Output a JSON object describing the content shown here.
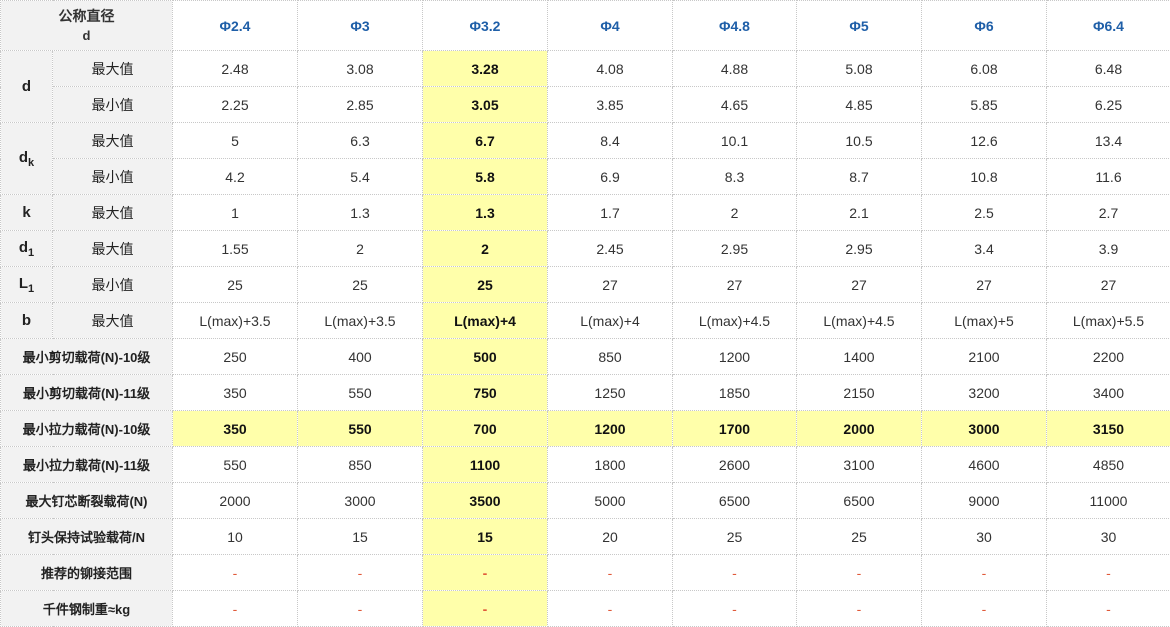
{
  "header": {
    "title_line1": "公称直径",
    "title_line2": "d",
    "columns": [
      "Φ2.4",
      "Φ3",
      "Φ3.2",
      "Φ4",
      "Φ4.8",
      "Φ5",
      "Φ6",
      "Φ6.4"
    ]
  },
  "highlight": {
    "column_index": 2,
    "row_label": "最小拉力载荷(N)-10级",
    "color": "#ffffaa"
  },
  "groups": [
    {
      "symbol": "d",
      "sub": "",
      "rows": [
        {
          "label": "最大值",
          "values": [
            "2.48",
            "3.08",
            "3.28",
            "4.08",
            "4.88",
            "5.08",
            "6.08",
            "6.48"
          ]
        },
        {
          "label": "最小值",
          "values": [
            "2.25",
            "2.85",
            "3.05",
            "3.85",
            "4.65",
            "4.85",
            "5.85",
            "6.25"
          ]
        }
      ]
    },
    {
      "symbol": "d",
      "sub": "k",
      "rows": [
        {
          "label": "最大值",
          "values": [
            "5",
            "6.3",
            "6.7",
            "8.4",
            "10.1",
            "10.5",
            "12.6",
            "13.4"
          ]
        },
        {
          "label": "最小值",
          "values": [
            "4.2",
            "5.4",
            "5.8",
            "6.9",
            "8.3",
            "8.7",
            "10.8",
            "11.6"
          ]
        }
      ]
    },
    {
      "symbol": "k",
      "sub": "",
      "rows": [
        {
          "label": "最大值",
          "values": [
            "1",
            "1.3",
            "1.3",
            "1.7",
            "2",
            "2.1",
            "2.5",
            "2.7"
          ]
        }
      ]
    },
    {
      "symbol": "d",
      "sub": "1",
      "rows": [
        {
          "label": "最大值",
          "values": [
            "1.55",
            "2",
            "2",
            "2.45",
            "2.95",
            "2.95",
            "3.4",
            "3.9"
          ]
        }
      ]
    },
    {
      "symbol": "L",
      "sub": "1",
      "rows": [
        {
          "label": "最小值",
          "values": [
            "25",
            "25",
            "25",
            "27",
            "27",
            "27",
            "27",
            "27"
          ]
        }
      ]
    },
    {
      "symbol": "b",
      "sub": "",
      "rows": [
        {
          "label": "最大值",
          "values": [
            "L(max)+3.5",
            "L(max)+3.5",
            "L(max)+4",
            "L(max)+4",
            "L(max)+4.5",
            "L(max)+4.5",
            "L(max)+5",
            "L(max)+5.5"
          ]
        }
      ]
    }
  ],
  "wide_rows": [
    {
      "label": "最小剪切载荷(N)-10级",
      "values": [
        "250",
        "400",
        "500",
        "850",
        "1200",
        "1400",
        "2100",
        "2200"
      ]
    },
    {
      "label": "最小剪切载荷(N)-11级",
      "values": [
        "350",
        "550",
        "750",
        "1250",
        "1850",
        "2150",
        "3200",
        "3400"
      ]
    },
    {
      "label": "最小拉力载荷(N)-10级",
      "values": [
        "350",
        "550",
        "700",
        "1200",
        "1700",
        "2000",
        "3000",
        "3150"
      ]
    },
    {
      "label": "最小拉力载荷(N)-11级",
      "values": [
        "550",
        "850",
        "1100",
        "1800",
        "2600",
        "3100",
        "4600",
        "4850"
      ]
    },
    {
      "label": "最大钉芯断裂载荷(N)",
      "values": [
        "2000",
        "3000",
        "3500",
        "5000",
        "6500",
        "6500",
        "9000",
        "11000"
      ]
    },
    {
      "label": "钉头保持试验载荷/N",
      "values": [
        "10",
        "15",
        "15",
        "20",
        "25",
        "25",
        "30",
        "30"
      ]
    },
    {
      "label": "推荐的铆接范围",
      "values": [
        "-",
        "-",
        "-",
        "-",
        "-",
        "-",
        "-",
        "-"
      ]
    },
    {
      "label": "千件钢制重≈kg",
      "values": [
        "-",
        "-",
        "-",
        "-",
        "-",
        "-",
        "-",
        "-"
      ]
    }
  ]
}
